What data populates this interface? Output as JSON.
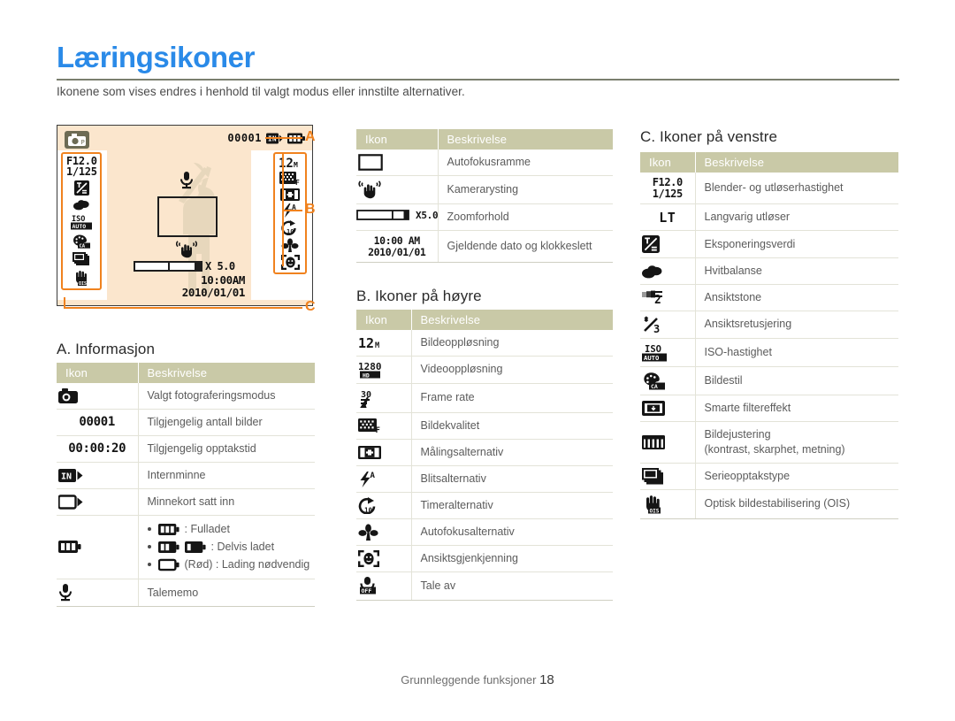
{
  "page": {
    "title": "Læringsikoner",
    "intro": "Ikonene som vises endres i henhold til valgt modus eller innstilte alternativer.",
    "footer_label": "Grunnleggende funksjoner",
    "footer_page": "18",
    "accent_color": "#2a8ae8",
    "callout_color": "#f0821e",
    "table_header_color": "#c9c9a7"
  },
  "lcd": {
    "mode_icon": "camera-program-mode-icon",
    "shots_remaining": "00001",
    "memory_icon": "internal-memory-icon",
    "battery_icon": "battery-full-icon",
    "aperture": "F12.0",
    "shutter": "1/125",
    "left_icons": [
      "exposure-value-icon",
      "white-balance-cloudy-icon",
      "iso-auto-icon",
      "photo-style-icon",
      "burst-type-icon",
      "ois-icon"
    ],
    "right_icons": [
      "resolution-12m-icon",
      "quality-fine-icon",
      "metering-icon",
      "flash-auto-icon",
      "timer-10s-icon",
      "macro-icon",
      "face-detection-icon"
    ],
    "zoom_label": "X 5.0",
    "time": "10:00AM",
    "date": "2010/01/01",
    "callouts": [
      "A",
      "B",
      "C"
    ]
  },
  "tables": {
    "columns": {
      "icon": "Ikon",
      "description": "Beskrivelse"
    },
    "a_info": {
      "title": "A. Informasjon",
      "rows": [
        {
          "icon": "camera-program-mode-icon",
          "icon_text": "",
          "desc": "Valgt fotograferingsmodus"
        },
        {
          "icon": "shots-remaining-icon",
          "icon_text": "00001",
          "desc": "Tilgjengelig antall bilder"
        },
        {
          "icon": "recording-time-icon",
          "icon_text": "00:00:20",
          "desc": "Tilgjengelig opptakstid"
        },
        {
          "icon": "internal-memory-icon",
          "icon_text": "",
          "desc": "Internminne"
        },
        {
          "icon": "memory-card-icon",
          "icon_text": "",
          "desc": "Minnekort satt inn"
        },
        {
          "icon": "battery-full-icon",
          "icon_text": "",
          "desc": "",
          "battery": [
            {
              "icons": [
                "battery-full-icon"
              ],
              "label": ": Fulladet"
            },
            {
              "icons": [
                "battery-half-icon",
                "battery-low-icon"
              ],
              "label": ": Delvis ladet"
            },
            {
              "icons": [
                "battery-empty-icon"
              ],
              "label": "(Rød) : Lading nødvendig"
            }
          ]
        },
        {
          "icon": "voice-memo-icon",
          "icon_text": "",
          "desc": "Talememo"
        }
      ]
    },
    "a_top_right": {
      "title": "",
      "rows": [
        {
          "icon": "af-frame-icon",
          "icon_text": "",
          "desc": "Autofokusramme"
        },
        {
          "icon": "camera-shake-icon",
          "icon_text": "",
          "desc": "Kamerarysting"
        },
        {
          "icon": "zoom-ratio-icon",
          "icon_text": "X5.0",
          "desc": "Zoomforhold"
        },
        {
          "icon": "date-time-icon",
          "icon_text": "10:00 AM\n2010/01/01",
          "desc": "Gjeldende dato og klokkeslett"
        }
      ]
    },
    "b_right": {
      "title": "B. Ikoner på høyre",
      "rows": [
        {
          "icon": "resolution-12m-icon",
          "desc": "Bildeoppløsning"
        },
        {
          "icon": "video-resolution-1280hd-icon",
          "desc": "Videooppløsning"
        },
        {
          "icon": "frame-rate-30-icon",
          "desc": "Frame rate"
        },
        {
          "icon": "quality-fine-icon",
          "desc": "Bildekvalitet"
        },
        {
          "icon": "metering-icon",
          "desc": "Målingsalternativ"
        },
        {
          "icon": "flash-auto-icon",
          "desc": "Blitsalternativ"
        },
        {
          "icon": "timer-10s-icon",
          "desc": "Timeralternativ"
        },
        {
          "icon": "macro-icon",
          "desc": "Autofokusalternativ"
        },
        {
          "icon": "face-detection-icon",
          "desc": "Ansiktsgjenkjenning"
        },
        {
          "icon": "voice-off-icon",
          "desc": "Tale av"
        }
      ]
    },
    "c_left": {
      "title": "C. Ikoner på venstre",
      "rows": [
        {
          "icon": "aperture-shutter-icon",
          "icon_text": "F12.0\n1/125",
          "desc": "Blender- og utløserhastighet"
        },
        {
          "icon": "long-time-shutter-icon",
          "icon_text": "LT",
          "desc": "Langvarig utløser"
        },
        {
          "icon": "exposure-value-icon",
          "desc": "Eksponeringsverdi"
        },
        {
          "icon": "white-balance-cloudy-icon",
          "desc": "Hvitbalanse"
        },
        {
          "icon": "face-tone-icon",
          "desc": "Ansiktstone"
        },
        {
          "icon": "face-retouch-icon",
          "desc": "Ansiktsretusjering"
        },
        {
          "icon": "iso-auto-icon",
          "desc": "ISO-hastighet"
        },
        {
          "icon": "photo-style-icon",
          "desc": "Bildestil"
        },
        {
          "icon": "smart-filter-icon",
          "desc": "Smarte filtereffekt"
        },
        {
          "icon": "image-adjust-icon",
          "desc": "Bildejustering\n(kontrast, skarphet, metning)"
        },
        {
          "icon": "burst-type-icon",
          "desc": "Serieopptakstype"
        },
        {
          "icon": "ois-icon",
          "desc": "Optisk bildestabilisering (OIS)"
        }
      ]
    }
  }
}
